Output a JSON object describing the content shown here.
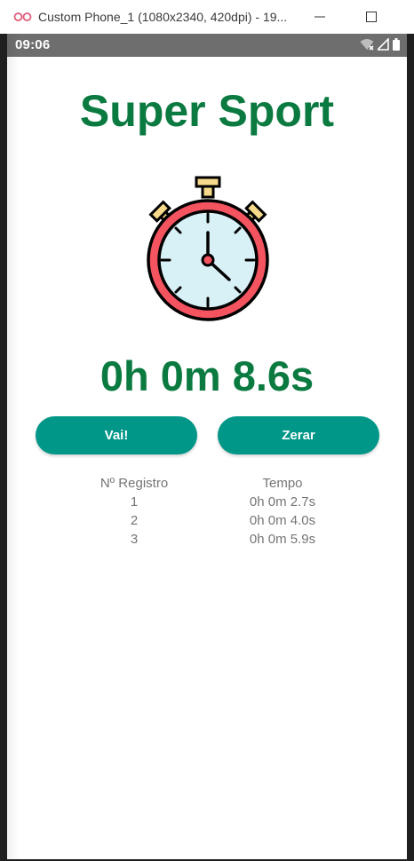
{
  "window": {
    "title": "Custom Phone_1 (1080x2340, 420dpi) - 19...",
    "minimize_glyph": "—",
    "maximize_glyph": "☐"
  },
  "status_bar": {
    "time": "09:06",
    "icons": [
      "wifi-icon",
      "signal-icon",
      "battery-icon"
    ]
  },
  "app": {
    "title": "Super Sport",
    "timer": "0h 0m 8.6s",
    "buttons": {
      "go": "Vai!",
      "reset": "Zerar"
    },
    "records": {
      "headers": [
        "Nº Registro",
        "Tempo"
      ],
      "rows": [
        [
          "1",
          "0h 0m 2.7s"
        ],
        [
          "2",
          "0h 0m 4.0s"
        ],
        [
          "3",
          "0h 0m 5.9s"
        ]
      ]
    }
  },
  "colors": {
    "brand_green": "#0a7a40",
    "button_teal": "#009688",
    "status_bar": "#6e6e6e"
  }
}
